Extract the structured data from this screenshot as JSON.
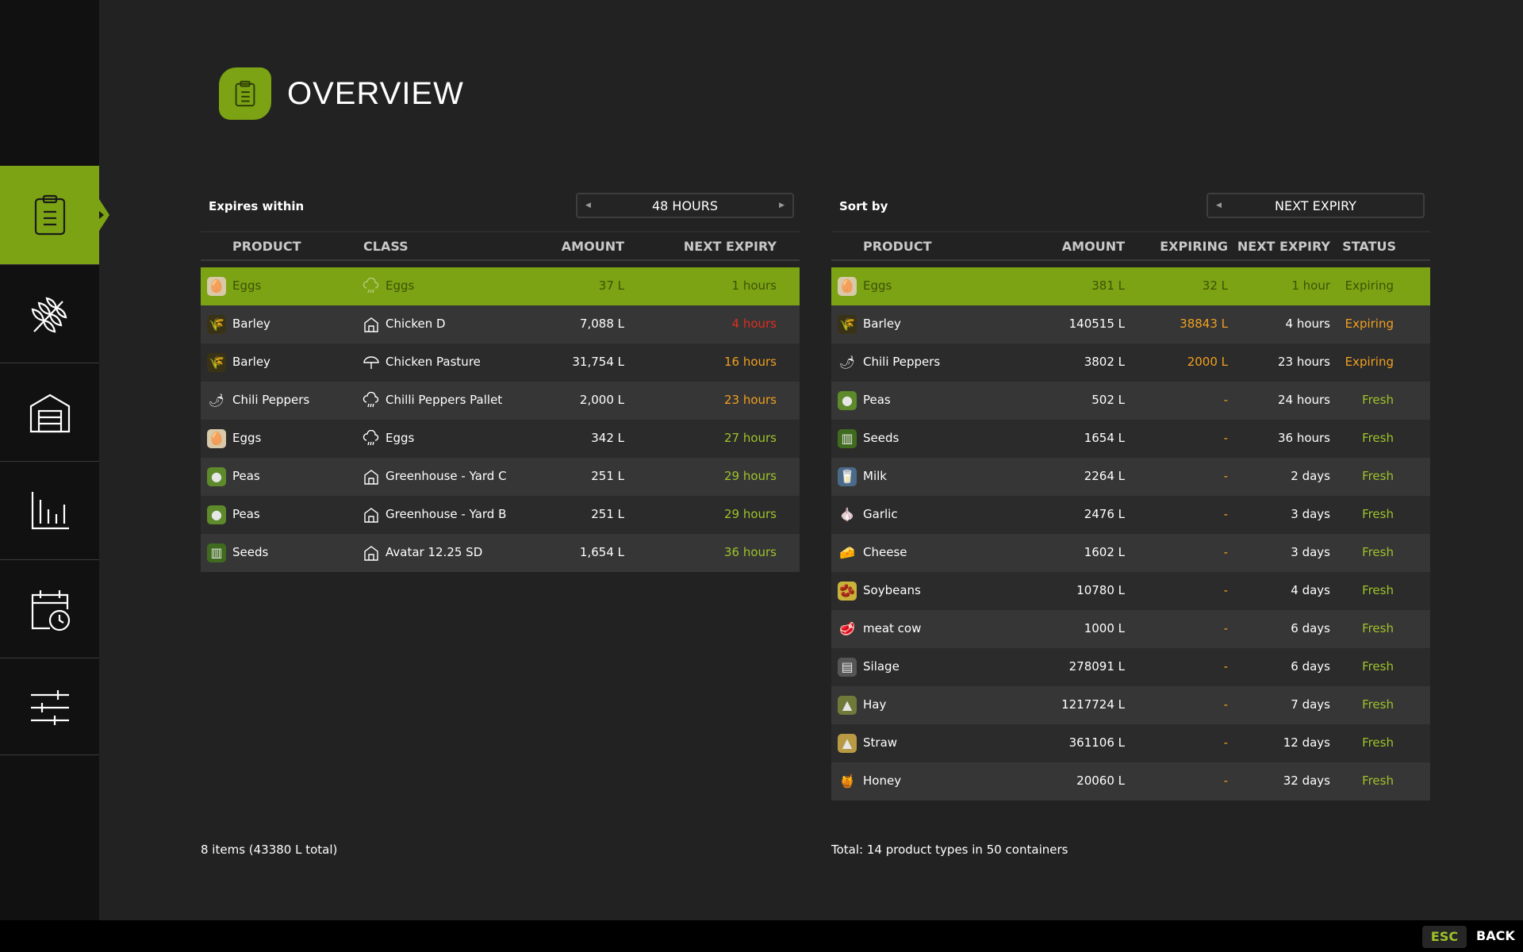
{
  "header": {
    "title": "OVERVIEW",
    "icon": "clipboard-icon"
  },
  "sidebar": {
    "items": [
      {
        "icon": "clipboard-icon",
        "active": true
      },
      {
        "icon": "wheat-icon",
        "active": false
      },
      {
        "icon": "barn-icon",
        "active": false
      },
      {
        "icon": "bar-chart-icon",
        "active": false
      },
      {
        "icon": "calendar-clock-icon",
        "active": false
      },
      {
        "icon": "sliders-icon",
        "active": false
      }
    ]
  },
  "left": {
    "label": "Expires within",
    "selector": "48 HOURS",
    "headers": {
      "product": "PRODUCT",
      "class": "CLASS",
      "amount": "AMOUNT",
      "next_expiry": "NEXT EXPIRY"
    },
    "rows": [
      {
        "product": "Eggs",
        "icon": "egg-icon",
        "class": "Eggs",
        "class_icon": "rain-icon",
        "amount": "37 L",
        "next_expiry": "1 hours",
        "status_color": "selected"
      },
      {
        "product": "Barley",
        "icon": "barley-icon",
        "class": "Chicken D",
        "class_icon": "house-icon",
        "amount": "7,088 L",
        "next_expiry": "4 hours",
        "status_color": "#e02d20"
      },
      {
        "product": "Barley",
        "icon": "barley-icon",
        "class": "Chicken Pasture",
        "class_icon": "umbrella-icon",
        "amount": "31,754 L",
        "next_expiry": "16 hours",
        "status_color": "#f0a020"
      },
      {
        "product": "Chili Peppers",
        "icon": "chili-icon",
        "class": "Chilli Peppers Pallet",
        "class_icon": "rain-icon",
        "amount": "2,000 L",
        "next_expiry": "23 hours",
        "status_color": "#f0a020"
      },
      {
        "product": "Eggs",
        "icon": "egg-icon",
        "class": "Eggs",
        "class_icon": "rain-icon",
        "amount": "342 L",
        "next_expiry": "27 hours",
        "status_color": "#9ec32a"
      },
      {
        "product": "Peas",
        "icon": "peas-icon",
        "class": "Greenhouse - Yard C",
        "class_icon": "house-icon",
        "amount": "251 L",
        "next_expiry": "29 hours",
        "status_color": "#9ec32a"
      },
      {
        "product": "Peas",
        "icon": "peas-icon",
        "class": "Greenhouse - Yard B",
        "class_icon": "house-icon",
        "amount": "251 L",
        "next_expiry": "29 hours",
        "status_color": "#9ec32a"
      },
      {
        "product": "Seeds",
        "icon": "seeds-icon",
        "class": "Avatar 12.25 SD",
        "class_icon": "house-icon",
        "amount": "1,654 L",
        "next_expiry": "36 hours",
        "status_color": "#9ec32a"
      }
    ],
    "footer": "8 items (43380 L total)"
  },
  "right": {
    "label": "Sort by",
    "selector": "NEXT EXPIRY",
    "headers": {
      "product": "PRODUCT",
      "amount": "AMOUNT",
      "expiring": "EXPIRING",
      "next_expiry": "NEXT EXPIRY",
      "status": "STATUS"
    },
    "rows": [
      {
        "product": "Eggs",
        "icon": "egg-icon",
        "amount": "381 L",
        "expiring": "32 L",
        "next_expiry": "1 hour",
        "status": "Expiring"
      },
      {
        "product": "Barley",
        "icon": "barley-icon",
        "amount": "140515 L",
        "expiring": "38843 L",
        "next_expiry": "4 hours",
        "status": "Expiring"
      },
      {
        "product": "Chili Peppers",
        "icon": "chili-icon",
        "amount": "3802 L",
        "expiring": "2000 L",
        "next_expiry": "23 hours",
        "status": "Expiring"
      },
      {
        "product": "Peas",
        "icon": "peas-icon",
        "amount": "502 L",
        "expiring": "-",
        "next_expiry": "24 hours",
        "status": "Fresh"
      },
      {
        "product": "Seeds",
        "icon": "seeds-icon",
        "amount": "1654 L",
        "expiring": "-",
        "next_expiry": "36 hours",
        "status": "Fresh"
      },
      {
        "product": "Milk",
        "icon": "milk-icon",
        "amount": "2264 L",
        "expiring": "-",
        "next_expiry": "2 days",
        "status": "Fresh"
      },
      {
        "product": "Garlic",
        "icon": "garlic-icon",
        "amount": "2476 L",
        "expiring": "-",
        "next_expiry": "3 days",
        "status": "Fresh"
      },
      {
        "product": "Cheese",
        "icon": "cheese-icon",
        "amount": "1602 L",
        "expiring": "-",
        "next_expiry": "3 days",
        "status": "Fresh"
      },
      {
        "product": "Soybeans",
        "icon": "soybeans-icon",
        "amount": "10780 L",
        "expiring": "-",
        "next_expiry": "4 days",
        "status": "Fresh"
      },
      {
        "product": "meat cow",
        "icon": "meat-icon",
        "amount": "1000 L",
        "expiring": "-",
        "next_expiry": "6 days",
        "status": "Fresh"
      },
      {
        "product": "Silage",
        "icon": "silage-icon",
        "amount": "278091 L",
        "expiring": "-",
        "next_expiry": "6 days",
        "status": "Fresh"
      },
      {
        "product": "Hay",
        "icon": "hay-icon",
        "amount": "1217724 L",
        "expiring": "-",
        "next_expiry": "7 days",
        "status": "Fresh"
      },
      {
        "product": "Straw",
        "icon": "straw-icon",
        "amount": "361106 L",
        "expiring": "-",
        "next_expiry": "12 days",
        "status": "Fresh"
      },
      {
        "product": "Honey",
        "icon": "honey-icon",
        "amount": "20060 L",
        "expiring": "-",
        "next_expiry": "32 days",
        "status": "Fresh"
      }
    ],
    "footer": "Total: 14 product types in 50 containers"
  },
  "bottombar": {
    "esc": "ESC",
    "back": "BACK"
  },
  "colors": {
    "accent": "#7ba313",
    "red": "#e02d20",
    "orange": "#f0a020",
    "green": "#9ec32a"
  }
}
